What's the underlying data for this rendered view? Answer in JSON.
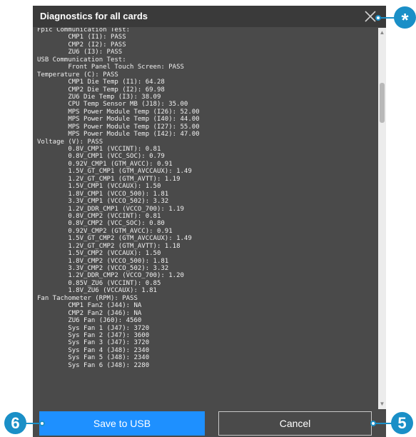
{
  "dialog": {
    "title": "Diagnostics for all cards",
    "lines": [
      "Fpic Communication Test:",
      "        CMP1 (I1): PASS",
      "        CMP2 (I2): PASS",
      "        ZU6 (I3): PASS",
      "USB Communication Test:",
      "        Front Panel Touch Screen: PASS",
      "Temperature (C): PASS",
      "        CMP1 Die Temp (I1): 64.28",
      "        CMP2 Die Temp (I2): 69.98",
      "        ZU6 Die Temp (I3): 38.09",
      "        CPU Temp Sensor MB (J18): 35.00",
      "        MPS Power Module Temp (I26): 52.00",
      "        MPS Power Module Temp (I40): 44.00",
      "        MPS Power Module Temp (I27): 55.00",
      "        MPS Power Module Temp (I42): 47.00",
      "Voltage (V): PASS",
      "        0.8V_CMP1 (VCCINT): 0.81",
      "        0.8V_CMP1 (VCC_SOC): 0.79",
      "        0.92V_CMP1 (GTM_AVCC): 0.91",
      "        1.5V_GT_CMP1 (GTM_AVCCAUX): 1.49",
      "        1.2V_GT_CMP1 (GTM_AVTT): 1.19",
      "        1.5V_CMP1 (VCCAUX): 1.50",
      "        1.8V_CMP1 (VCCO_500): 1.81",
      "        3.3V_CMP1 (VCCO_502): 3.32",
      "        1.2V_DDR_CMP1 (VCCO_700): 1.19",
      "        0.8V_CMP2 (VCCINT): 0.81",
      "        0.8V_CMP2 (VCC_SOC): 0.80",
      "        0.92V_CMP2 (GTM_AVCC): 0.91",
      "        1.5V_GT_CMP2 (GTM_AVCCAUX): 1.49",
      "        1.2V_GT_CMP2 (GTM_AVTT): 1.18",
      "        1.5V_CMP2 (VCCAUX): 1.50",
      "        1.8V_CMP2 (VCCO_500): 1.81",
      "        3.3V_CMP2 (VCCO_502): 3.32",
      "        1.2V_DDR_CMP2 (VCCO_700): 1.20",
      "        0.85V_ZU6 (VCCINT): 0.85",
      "        1.8V_ZU6 (VCCAUX): 1.81",
      "Fan Tachometer (RPM): PASS",
      "        CMP1 Fan2 (J44): NA",
      "        CMP2 Fan2 (J46): NA",
      "        ZU6 Fan (J60): 4560",
      "        Sys Fan 1 (J47): 3720",
      "        Sys Fan 2 (J47): 3600",
      "        Sys Fan 3 (J47): 3720",
      "        Sys Fan 4 (J48): 2340",
      "        Sys Fan 5 (J48): 2340",
      "        Sys Fan 6 (J48): 2280"
    ],
    "save_button": "Save to USB",
    "cancel_button": "Cancel"
  },
  "callouts": {
    "close": "*",
    "save": "6",
    "cancel": "5"
  },
  "colors": {
    "dialog_bg": "#4a4a4a",
    "titlebar_bg": "#3a3a3a",
    "primary_button": "#1e90ff",
    "callout": "#1a8fc7"
  }
}
